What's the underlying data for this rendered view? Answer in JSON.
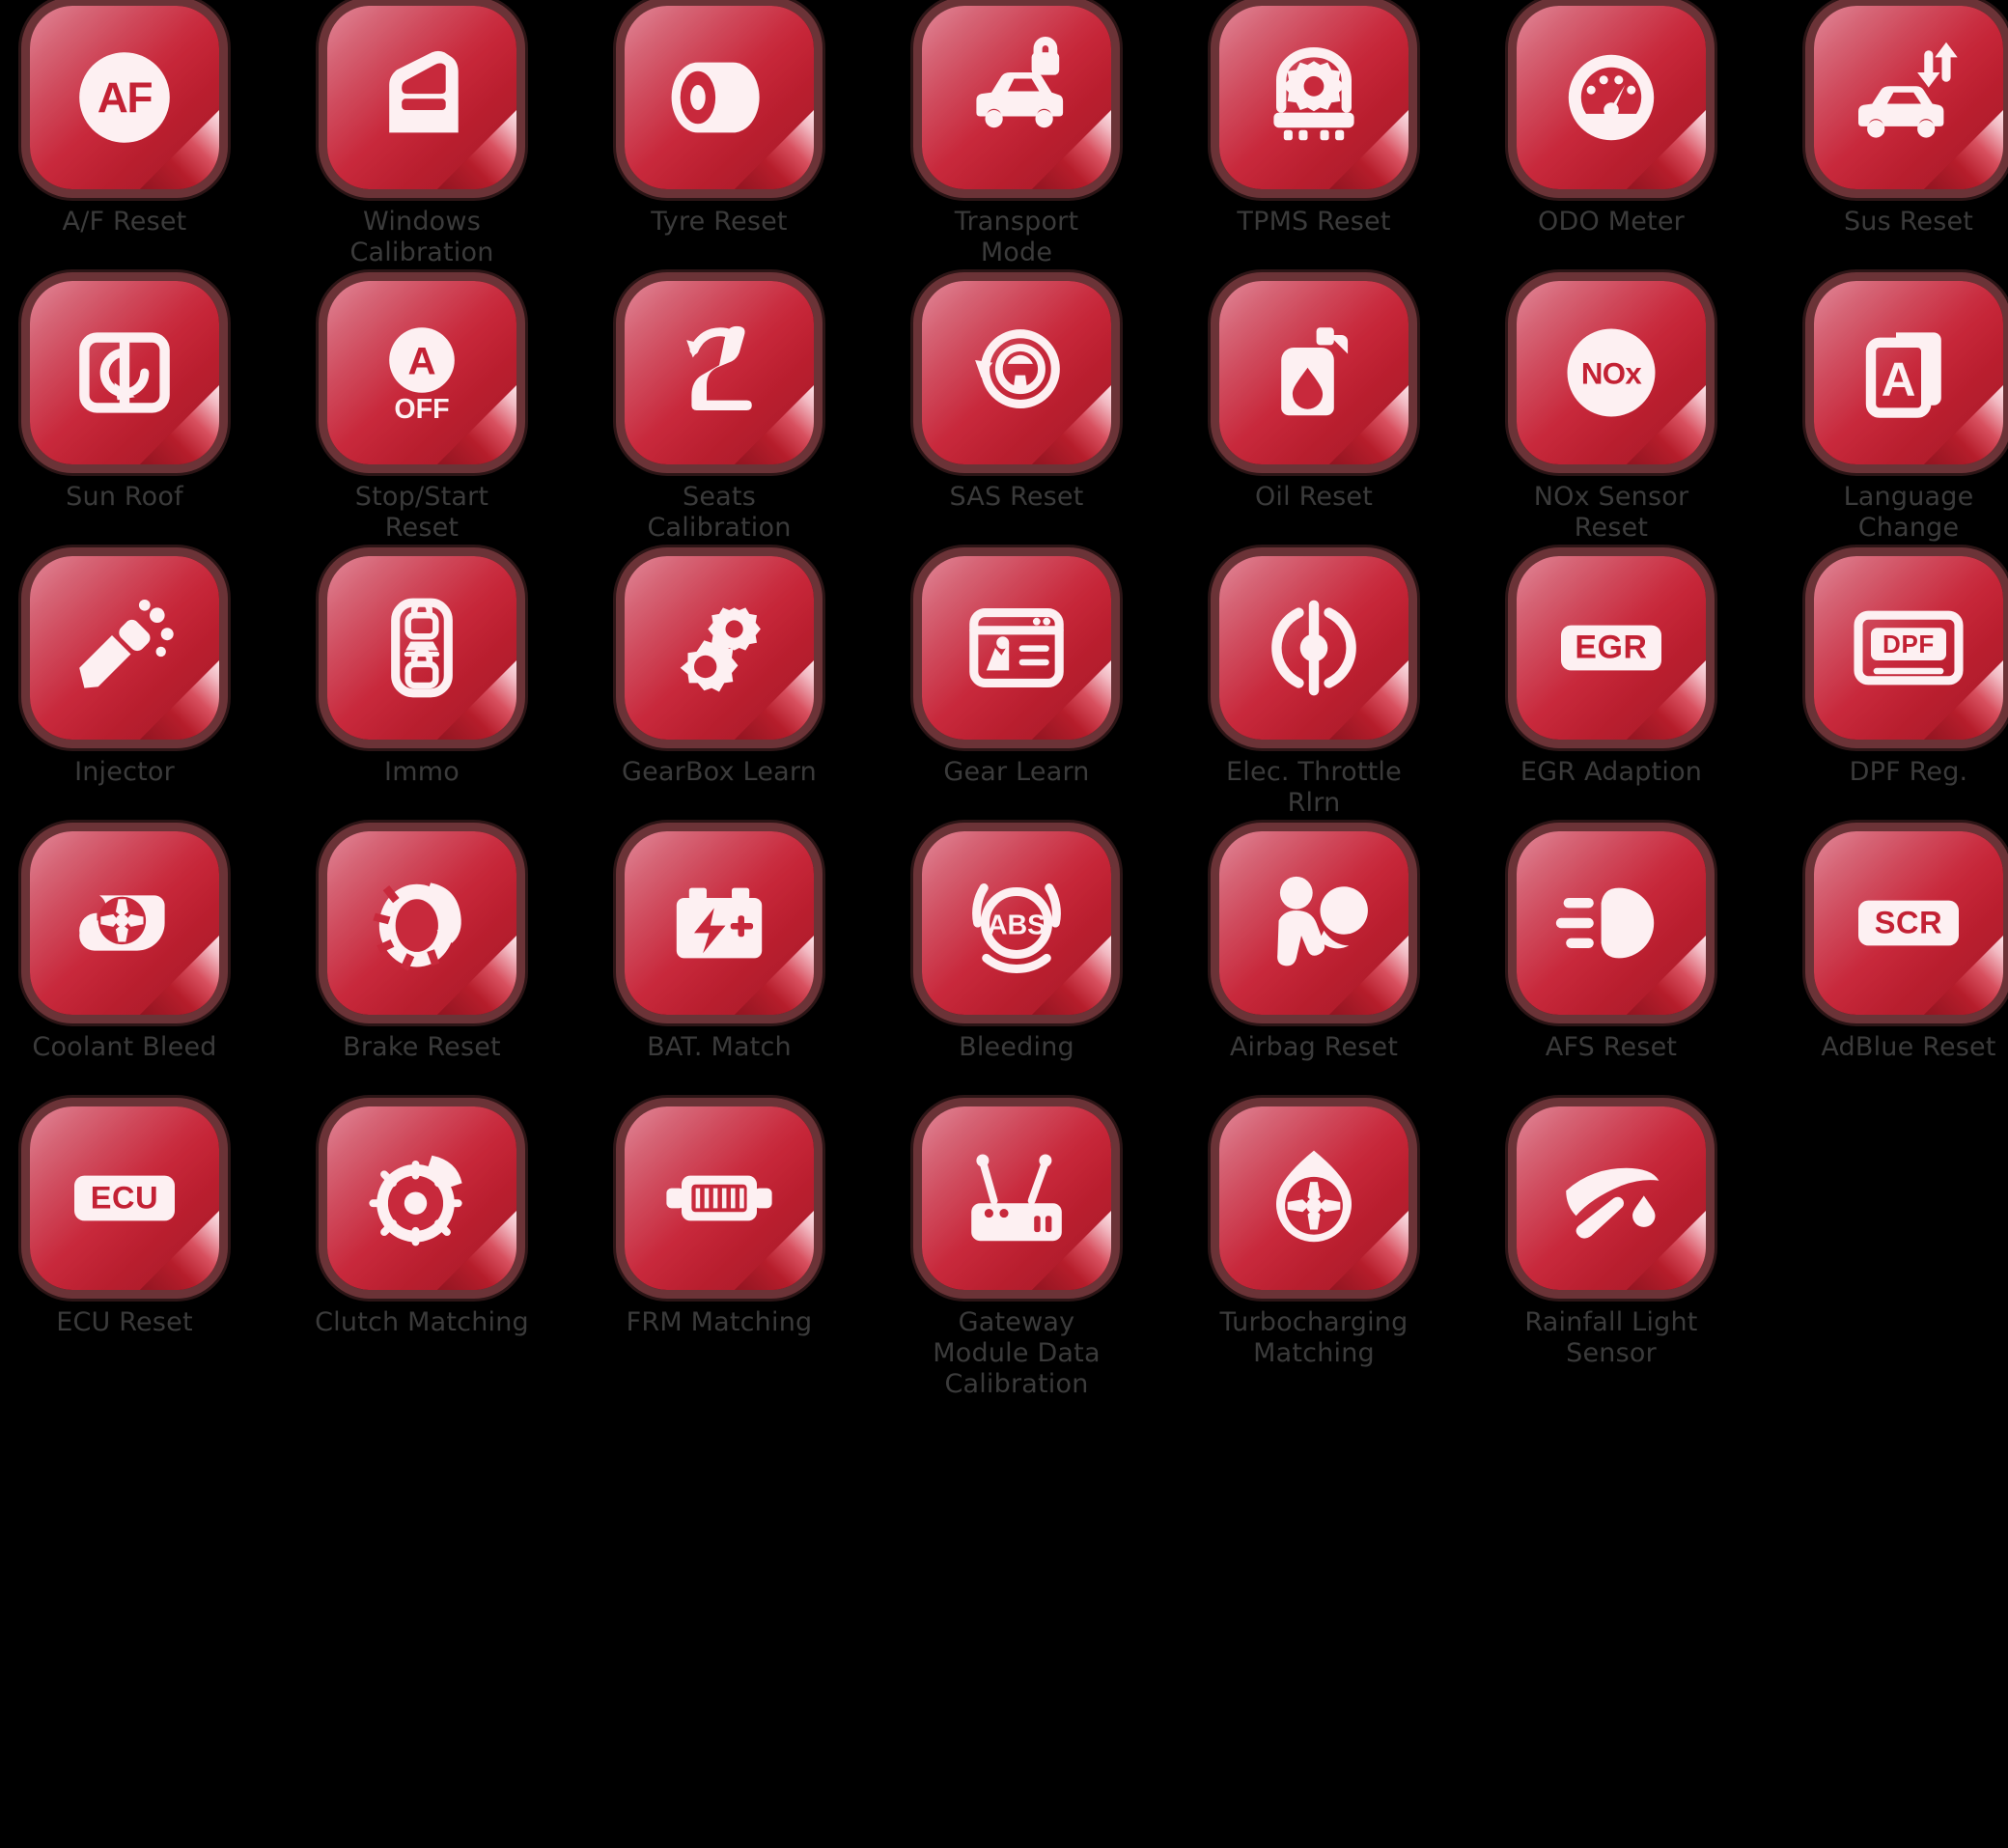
{
  "theme": {
    "background": "#000000",
    "tile_light": "#d9657a",
    "tile_mid": "#c8293c",
    "tile_dark": "#b81e2d",
    "tile_border": "#96484e",
    "glyph_color": "#fdf0f2",
    "label_color": "#3b3b3b"
  },
  "grid": {
    "columns": 7,
    "rows": 5,
    "total_items": 33
  },
  "items": [
    {
      "label": "A/F Reset",
      "icon": "af-badge-icon"
    },
    {
      "label": "Windows\nCalibration",
      "icon": "car-door-window-icon"
    },
    {
      "label": "Tyre Reset",
      "icon": "tyre-icon"
    },
    {
      "label": "Transport\nMode",
      "icon": "car-lock-icon"
    },
    {
      "label": "TPMS Reset",
      "icon": "tyre-pressure-gear-icon"
    },
    {
      "label": "ODO Meter",
      "icon": "odometer-gauge-icon"
    },
    {
      "label": "Sus Reset",
      "icon": "car-suspension-arrows-icon"
    },
    {
      "label": "Sun Roof",
      "icon": "sunroof-panel-icon"
    },
    {
      "label": "Stop/Start\nReset",
      "icon": "a-off-badge-icon"
    },
    {
      "label": "Seats Calibration",
      "icon": "car-seat-rotate-icon"
    },
    {
      "label": "SAS Reset",
      "icon": "steering-angle-sensor-icon"
    },
    {
      "label": "Oil Reset",
      "icon": "oil-can-icon"
    },
    {
      "label": "NOx Sensor\nReset",
      "icon": "nox-badge-icon"
    },
    {
      "label": "Language\nChange",
      "icon": "language-a-pages-icon"
    },
    {
      "label": "Injector",
      "icon": "fuel-injector-icon"
    },
    {
      "label": "Immo",
      "icon": "car-key-fob-icon"
    },
    {
      "label": "GearBox Learn",
      "icon": "gears-icon"
    },
    {
      "label": "Gear Learn",
      "icon": "gear-learn-window-icon"
    },
    {
      "label": "Elec. Throttle\nRlrn",
      "icon": "throttle-body-icon"
    },
    {
      "label": "EGR Adaption",
      "icon": "egr-badge-icon"
    },
    {
      "label": "DPF Reg.",
      "icon": "dpf-badge-icon"
    },
    {
      "label": "Coolant Bleed",
      "icon": "water-pump-icon"
    },
    {
      "label": "Brake Reset",
      "icon": "brake-disc-caliper-icon"
    },
    {
      "label": "BAT. Match",
      "icon": "battery-icon"
    },
    {
      "label": "Bleeding",
      "icon": "abs-badge-icon"
    },
    {
      "label": "Airbag Reset",
      "icon": "airbag-occupant-icon"
    },
    {
      "label": "AFS Reset",
      "icon": "headlamp-beam-icon"
    },
    {
      "label": "AdBlue Reset",
      "icon": "scr-badge-icon"
    },
    {
      "label": "ECU Reset",
      "icon": "ecu-badge-icon"
    },
    {
      "label": "Clutch Matching",
      "icon": "clutch-disc-icon"
    },
    {
      "label": "FRM Matching",
      "icon": "control-module-icon"
    },
    {
      "label": "Gateway\nModule Data\nCalibration",
      "icon": "gateway-router-icon"
    },
    {
      "label": "Turbocharging\nMatching",
      "icon": "turbocharger-icon"
    },
    {
      "label": "Rainfall Light\nSensor",
      "icon": "rain-light-sensor-icon"
    }
  ]
}
